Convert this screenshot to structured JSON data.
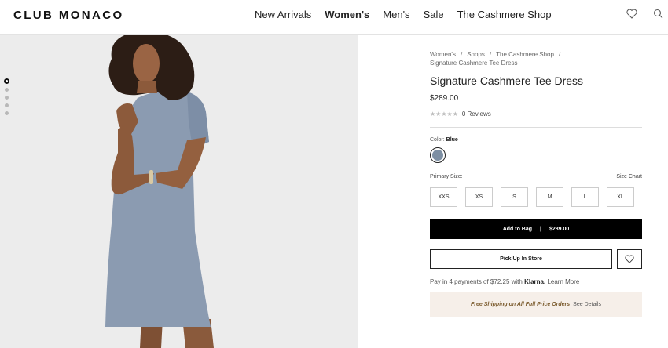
{
  "header": {
    "logo": "CLUB MONACO",
    "nav": [
      {
        "label": "New Arrivals",
        "bold": false
      },
      {
        "label": "Women's",
        "bold": true
      },
      {
        "label": "Men's",
        "bold": false
      },
      {
        "label": "Sale",
        "bold": false
      },
      {
        "label": "The Cashmere Shop",
        "bold": false
      }
    ],
    "icons": [
      "heart-icon",
      "search-icon"
    ]
  },
  "gallery": {
    "dot_count": 5,
    "active_index": 0,
    "image_bg": "#ececec"
  },
  "product": {
    "breadcrumb": [
      "Women's",
      "Shops",
      "The Cashmere Shop",
      "Signature Cashmere Tee Dress"
    ],
    "title": "Signature Cashmere Tee Dress",
    "price": "$289.00",
    "reviews": "0 Reviews",
    "color_label": "Color:",
    "color_value": "Blue",
    "swatch_color": "#7d8fa3",
    "size_label": "Primary Size:",
    "size_chart": "Size Chart",
    "sizes": [
      "XXS",
      "XS",
      "S",
      "M",
      "L",
      "XL"
    ],
    "add_to_bag": "Add to Bag",
    "add_to_bag_price": "$289.00",
    "pick_up": "Pick Up In Store",
    "klarna_prefix": "Pay in 4 payments of $72.25 with",
    "klarna_brand": "Klarna.",
    "klarna_link": "Learn More",
    "shipping_text": "Free Shipping on All Full Price Orders",
    "shipping_link": "See Details"
  }
}
